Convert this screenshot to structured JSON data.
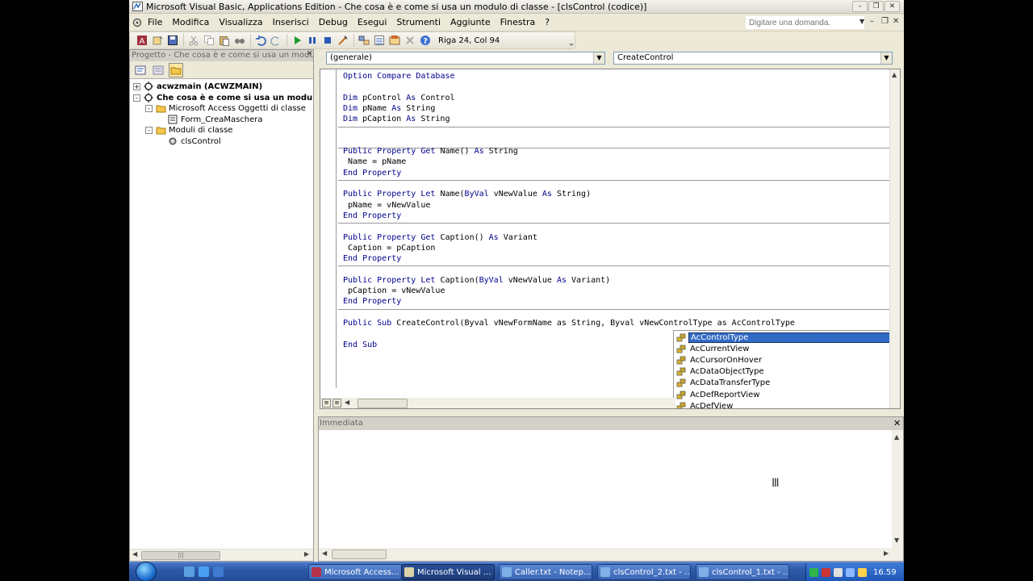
{
  "window": {
    "title": "Microsoft Visual Basic, Applications Edition - Che cosa è e come si usa un modulo di classe - [clsControl (codice)]"
  },
  "menu": {
    "items": [
      "File",
      "Modifica",
      "Visualizza",
      "Inserisci",
      "Debug",
      "Esegui",
      "Strumenti",
      "Aggiunte",
      "Finestra",
      "?"
    ],
    "help_placeholder": "Digitare una domanda."
  },
  "toolbar": {
    "position_label": "Riga 24, Col 94",
    "icons": [
      "access-icon",
      "insert-icon",
      "save-icon",
      "cut-icon",
      "copy-icon",
      "paste-icon",
      "find-icon",
      "undo-icon",
      "redo-icon",
      "run-icon",
      "pause-icon",
      "stop-icon",
      "design-icon",
      "project-explorer-icon",
      "properties-icon",
      "object-browser-icon",
      "toolbox-icon",
      "help-icon"
    ]
  },
  "project": {
    "title": "Progetto - Che cosa è e come si usa un modulo di cl",
    "tree": [
      {
        "label": "acwzmain (ACWZMAIN)",
        "bold": true,
        "expander": "+"
      },
      {
        "label": "Che cosa è e come si usa un modulo di cla",
        "bold": true,
        "expander": "-"
      },
      {
        "label": "Microsoft Access Oggetti di classe",
        "bold": false,
        "expander": "-"
      },
      {
        "label": "Form_CreaMaschera",
        "bold": false,
        "expander": ""
      },
      {
        "label": "Moduli di classe",
        "bold": false,
        "expander": "-"
      },
      {
        "label": "clsControl",
        "bold": false,
        "expander": ""
      }
    ]
  },
  "code": {
    "object_combo": "(generale)",
    "procedure_combo": "CreateControl",
    "lines": [
      "Option Compare Database",
      "",
      "Dim pControl As Control",
      "Dim pName As String",
      "Dim pCaption As String",
      "",
      "",
      "Public Property Get Name() As String",
      " Name = pName",
      "End Property",
      "",
      "Public Property Let Name(ByVal vNewValue As String)",
      " pName = vNewValue",
      "End Property",
      "",
      "Public Property Get Caption() As Variant",
      " Caption = pCaption",
      "End Property",
      "",
      "Public Property Let Caption(ByVal vNewValue As Variant)",
      " pCaption = vNewValue",
      "End Property",
      "",
      "Public Sub CreateControl(Byval vNewFormName as String, Byval vNewControlType as AcControlType",
      "",
      "End Sub"
    ],
    "autocomplete": [
      "AcControlType",
      "AcCurrentView",
      "AcCursorOnHover",
      "AcDataObjectType",
      "AcDataTransferType",
      "AcDefReportView",
      "AcDefView"
    ],
    "autocomplete_selected": 0
  },
  "immediate": {
    "title": "Immediata"
  },
  "taskbar": {
    "tasks": [
      {
        "label": "Microsoft Access...",
        "active": false,
        "color": "#b5334a"
      },
      {
        "label": "Microsoft Visual ...",
        "active": true,
        "color": "#d9d2a8"
      },
      {
        "label": "Caller.txt - Notep...",
        "active": false,
        "color": "#7fb0e8"
      },
      {
        "label": "clsControl_2.txt - ...",
        "active": false,
        "color": "#7fb0e8"
      },
      {
        "label": "clsControl_1.txt - ...",
        "active": false,
        "color": "#7fb0e8"
      }
    ],
    "clock": "16.59"
  }
}
